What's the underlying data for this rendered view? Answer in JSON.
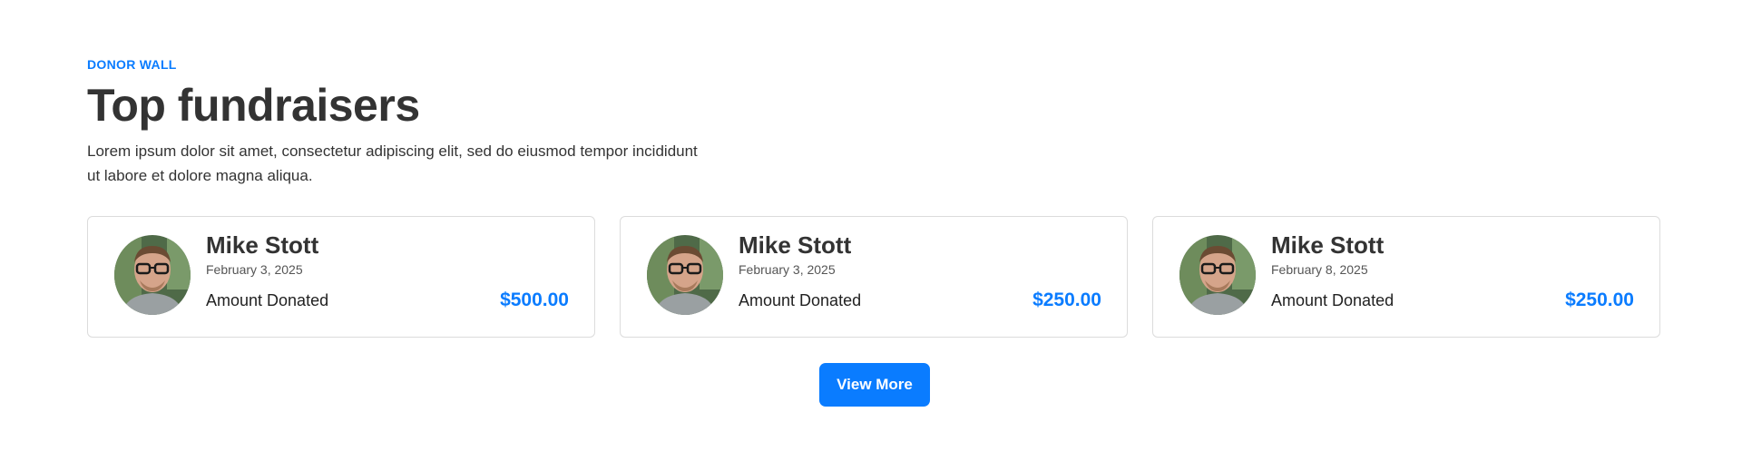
{
  "header": {
    "eyebrow": "DONOR WALL",
    "title": "Top fundraisers",
    "description": "Lorem ipsum dolor sit amet, consectetur adipiscing elit, sed do eiusmod tempor incididunt ut labore et dolore magna aliqua."
  },
  "cards": [
    {
      "name": "Mike Stott",
      "date": "February 3, 2025",
      "amount_label": "Amount Donated",
      "amount": "$500.00"
    },
    {
      "name": "Mike Stott",
      "date": "February 3, 2025",
      "amount_label": "Amount Donated",
      "amount": "$250.00"
    },
    {
      "name": "Mike Stott",
      "date": "February 8, 2025",
      "amount_label": "Amount Donated",
      "amount": "$250.00"
    }
  ],
  "view_more_label": "View More",
  "colors": {
    "accent": "#0a7cff",
    "text": "#333333",
    "border": "#dcdcdc"
  }
}
